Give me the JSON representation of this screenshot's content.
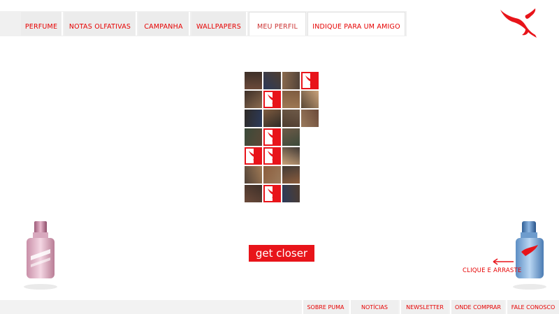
{
  "nav": {
    "tabs": [
      {
        "label": "PERFUME",
        "name": "tab-perfume"
      },
      {
        "label": "NOTAS OLFATIVAS",
        "name": "tab-notas-olfativas"
      },
      {
        "label": "CAMPANHA",
        "name": "tab-campanha"
      },
      {
        "label": "WALLPAPERS",
        "name": "tab-wallpapers"
      },
      {
        "label": "MEU PERFIL",
        "name": "tab-meu-perfil"
      },
      {
        "label": "INDIQUE PARA UM AMIGO",
        "name": "tab-indique-para-um-amigo"
      }
    ],
    "active_tab": "MEU PERFIL"
  },
  "logo": {
    "icon": "puma-cat-icon",
    "color": "#e8141a"
  },
  "grid": {
    "tiles": [
      [
        "photo",
        "photo",
        "photo",
        "puma"
      ],
      [
        "photo",
        "puma",
        "photo",
        "photo"
      ],
      [
        "photo",
        "photo",
        "photo",
        "photo"
      ],
      [
        "photo",
        "puma",
        "photo"
      ],
      [
        "puma",
        "puma",
        "photo"
      ],
      [
        "photo",
        "photo",
        "photo"
      ],
      [
        "photo",
        "puma",
        "photo"
      ]
    ]
  },
  "cta": {
    "label": "get closer"
  },
  "drag_hint": {
    "label": "CLIQUE E ARRASTE",
    "arrow_icon": "arrow-left-icon"
  },
  "bottles": {
    "left": "pink-perfume-bottle",
    "right": "blue-perfume-bottle"
  },
  "footer": {
    "links": [
      "SOBRE PUMA",
      "NOTÍCIAS",
      "NEWSLETTER",
      "ONDE COMPRAR",
      "FALE CONOSCO"
    ]
  },
  "colors": {
    "accent": "#e8141a",
    "nav_bg": "#ececec",
    "footer_bg": "#efefef"
  }
}
